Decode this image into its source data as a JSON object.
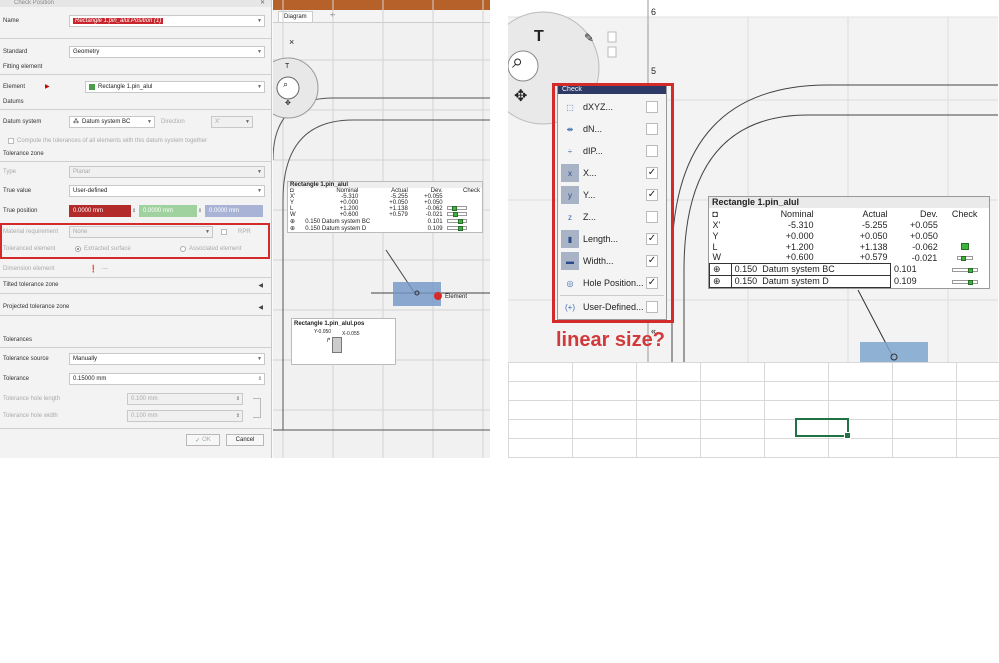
{
  "dialog": {
    "title": "Check Position",
    "name_label": "Name",
    "name_value": "Rectangle 1.pin_alul.Position (1)",
    "standard_label": "Standard",
    "standard_value": "Geometry",
    "fitting_section": "Fitting element",
    "element_label": "Element",
    "element_value": "Rectangle 1.pin_alul",
    "datums_section": "Datums",
    "datum_system_label": "Datum system",
    "datum_system_value": "Datum system BC",
    "direction_label": "Direction",
    "direction_value": "X'",
    "compute_all_label": "Compute the tolerances of all elements with this datum system together",
    "tol_zone_section": "Tolerance zone",
    "type_label": "Type",
    "type_value": "Planar",
    "true_value_label": "True value",
    "true_value_value": "User-defined",
    "true_position_label": "True position",
    "tp_x": "0.0000 mm",
    "tp_y": "0.0000 mm",
    "tp_z": "0.0000 mm",
    "material_req_label": "Material requirement",
    "material_req_value": "None",
    "rpr_label": "RPR",
    "toleranced_elem_label": "Toleranced element",
    "extracted_surface_label": "Extracted surface",
    "associated_element_label": "Associated element",
    "dimension_element_label": "Dimension element",
    "dimension_element_value": "---",
    "tilted_section": "Tilted tolerance zone",
    "projected_section": "Projected tolerance zone",
    "tolerances_section": "Tolerances",
    "tol_source_label": "Tolerance source",
    "tol_source_value": "Manually",
    "tolerance_label": "Tolerance",
    "tolerance_value": "0.15000 mm",
    "tol_hole_length_label": "Tolerance hole length",
    "tol_hole_length_value": "0.100 mm",
    "tol_hole_width_label": "Tolerance hole width",
    "tol_hole_width_value": "0.100 mm",
    "ok_label": "OK",
    "cancel_label": "Cancel"
  },
  "cad_left": {
    "tab_label": "Diagram",
    "tab_plus": "+",
    "close_x": "×",
    "element_tag": "Element",
    "pos_title": "Rectangle 1.pin_alul.pos",
    "pos_y": "Y-0.050",
    "pos_x": "X-0.055"
  },
  "result_table": {
    "title": "Rectangle 1.pin_alul",
    "headers": [
      "",
      "Nominal",
      "Actual",
      "Dev.",
      "Check"
    ],
    "rows": [
      {
        "axis": "X'",
        "nominal": "-5.310",
        "actual": "-5.255",
        "dev": "+0.055"
      },
      {
        "axis": "Y",
        "nominal": "+0.000",
        "actual": "+0.050",
        "dev": "+0.050"
      },
      {
        "axis": "L",
        "nominal": "+1.200",
        "actual": "+1.138",
        "dev": "-0.062"
      },
      {
        "axis": "W",
        "nominal": "+0.600",
        "actual": "+0.579",
        "dev": "-0.021"
      }
    ],
    "position_rows": [
      {
        "tol": "0.150",
        "datum": "Datum system BC",
        "actual": "0.101"
      },
      {
        "tol": "0.150",
        "datum": "Datum system D",
        "actual": "0.109"
      }
    ],
    "check_levels": [
      0.35,
      0.45,
      0.35,
      0.85,
      0.85
    ]
  },
  "check_menu": {
    "title": "Check",
    "items": [
      {
        "label": "dXYZ...",
        "checked": false
      },
      {
        "label": "dN...",
        "checked": false
      },
      {
        "label": "dIP...",
        "checked": false
      },
      {
        "label": "X...",
        "checked": true
      },
      {
        "label": "Y...",
        "checked": true
      },
      {
        "label": "Z...",
        "checked": false
      },
      {
        "label": "Length...",
        "checked": true
      },
      {
        "label": "Width...",
        "checked": true
      },
      {
        "label": "Hole Position...",
        "checked": true
      },
      {
        "label": "User-Defined...",
        "checked": false
      }
    ],
    "check_glyph": "✓"
  },
  "annotation": "linear size?",
  "right_numbers": {
    "n1": "6",
    "n2": "5"
  },
  "colors": {
    "highlight_red": "#d32a2a",
    "menu_title": "#2d3a66",
    "sheet_selection": "#207245",
    "orange_bar": "#b6612a"
  }
}
